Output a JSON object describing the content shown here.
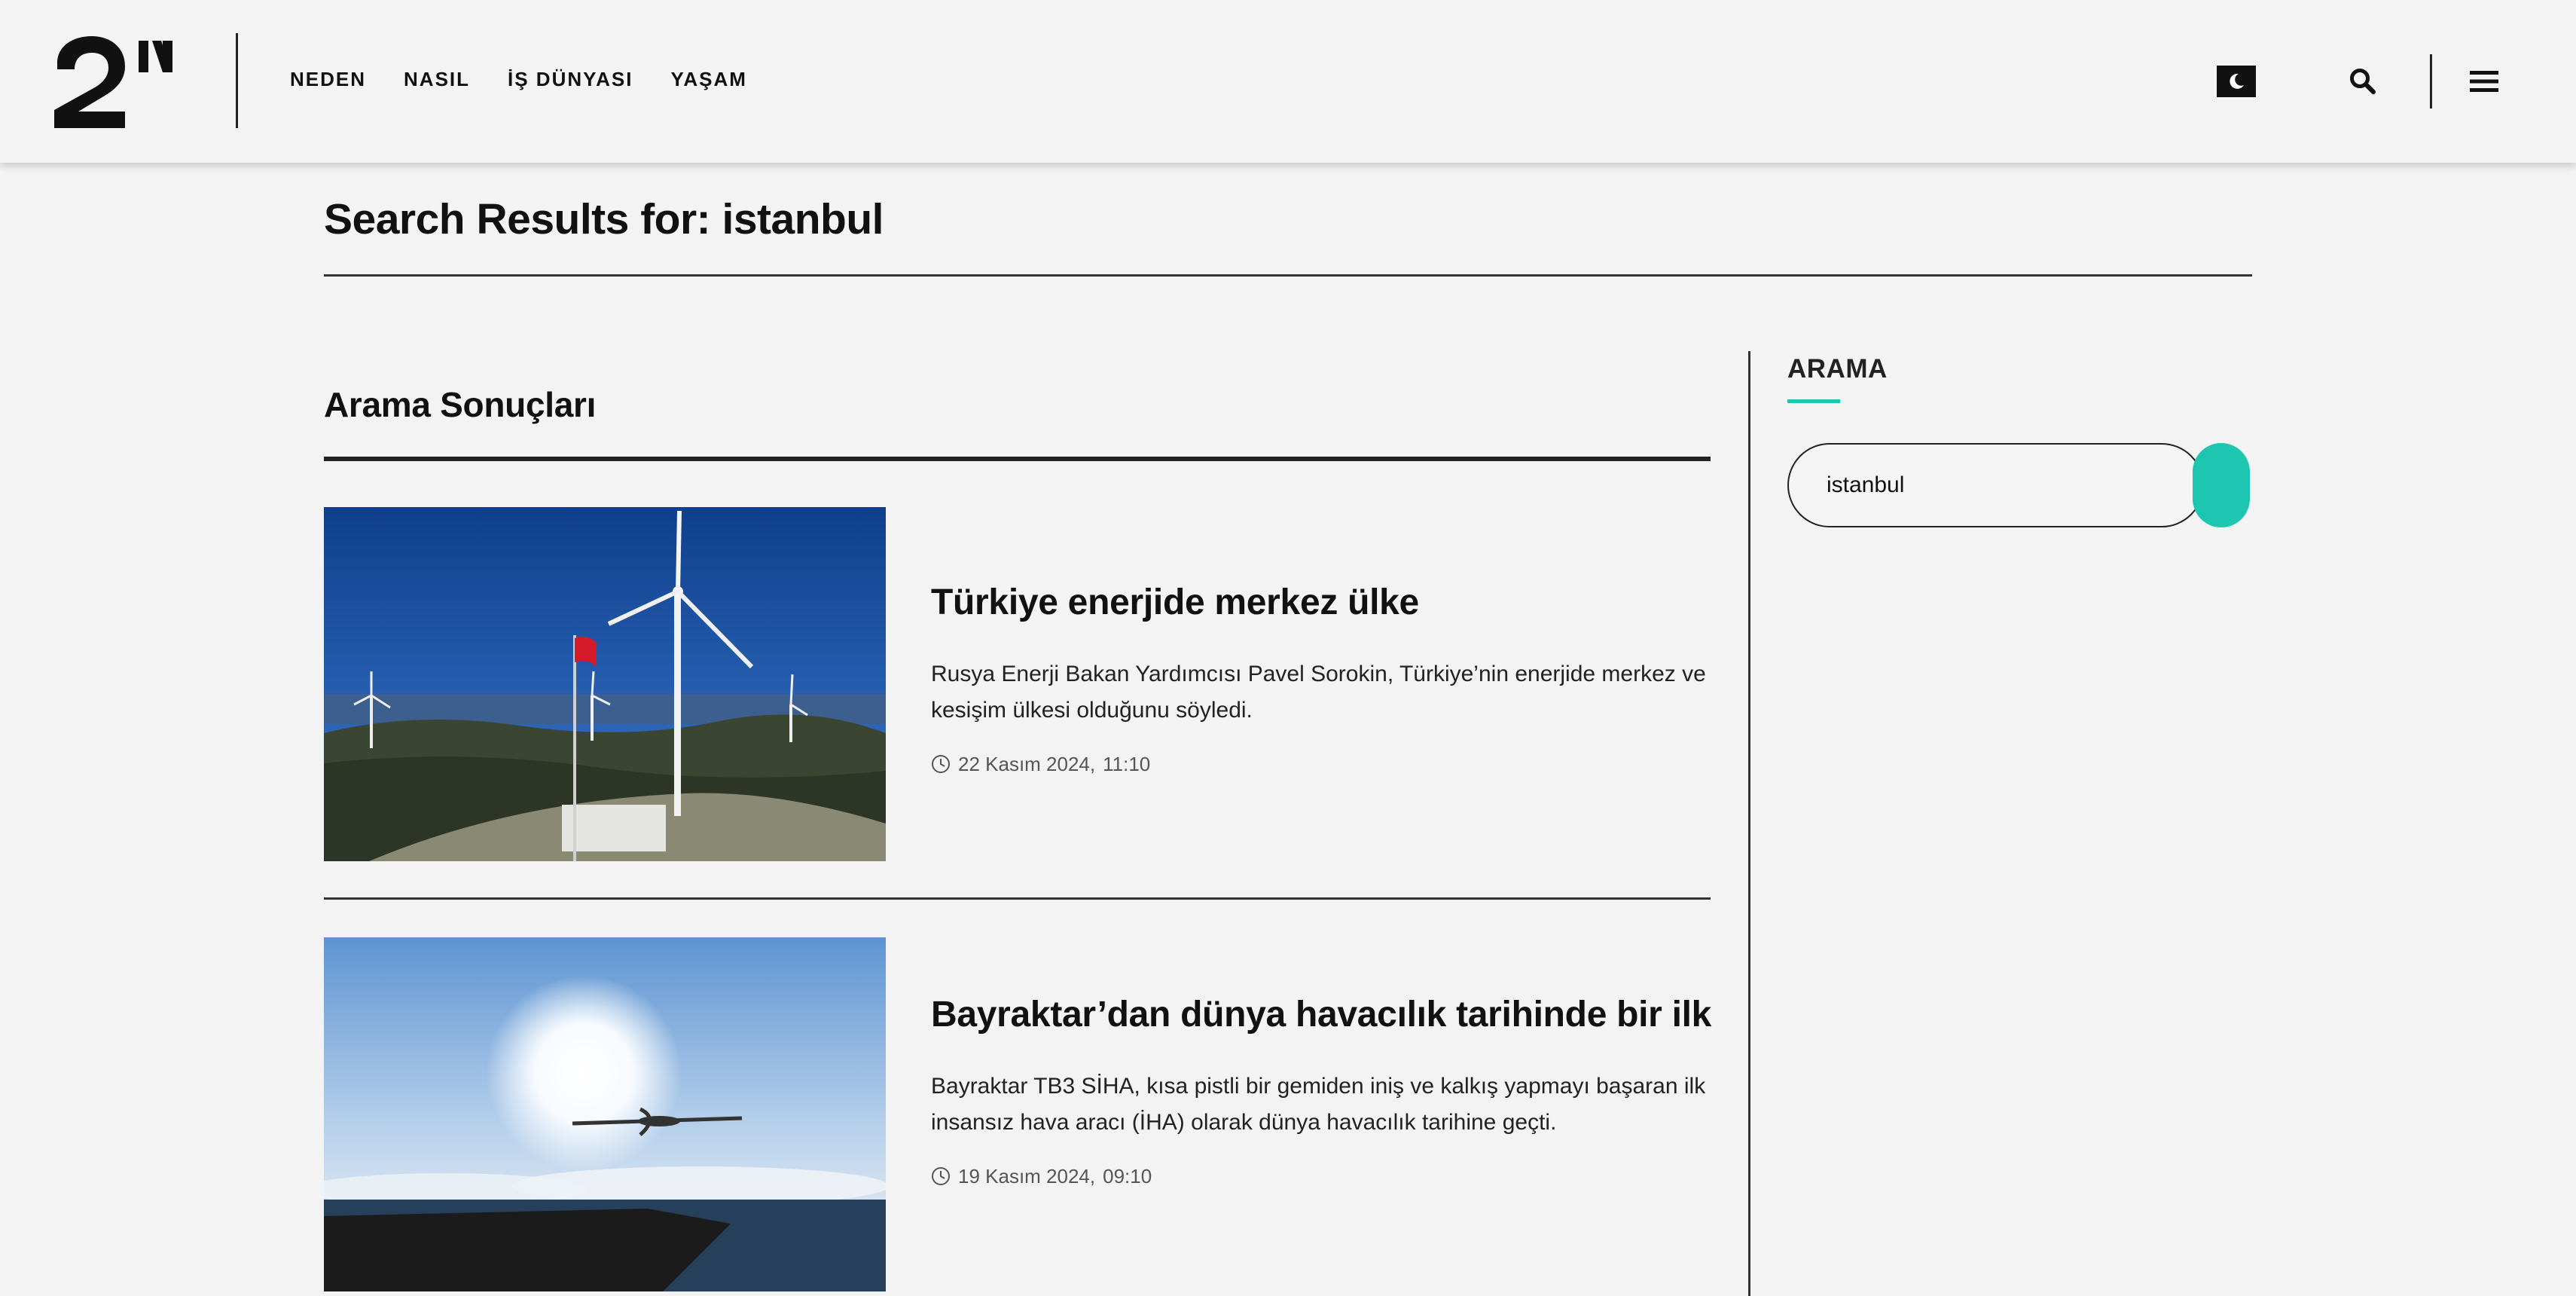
{
  "header": {
    "nav": [
      "NEDEN",
      "NASIL",
      "İŞ DÜNYASI",
      "YAŞAM"
    ]
  },
  "page": {
    "title": "Search Results for: istanbul",
    "section_title": "Arama Sonuçları"
  },
  "articles": [
    {
      "title": "Türkiye enerjide merkez ülke",
      "excerpt": "Rusya Enerji Bakan Yardımcısı Pavel Sorokin, Türkiye’nin enerjide merkez ve kesişim ülkesi olduğunu söyledi.",
      "date": "22 Kasım 2024,",
      "time": "11:10"
    },
    {
      "title": "Bayraktar’dan dünya havacılık tarihinde bir ilk",
      "excerpt": "Bayraktar TB3 SİHA, kısa pistli bir gemiden iniş ve kalkış yapmayı başaran ilk insansız hava aracı (İHA) olarak dünya havacılık tarihine geçti.",
      "date": "19 Kasım 2024,",
      "time": "09:10"
    }
  ],
  "sidebar": {
    "title": "ARAMA",
    "search_value": "istanbul"
  },
  "colors": {
    "accent": "#1dc6b0",
    "background": "#f3f3f3",
    "text": "#111111"
  },
  "icons": [
    "logo",
    "moon-icon",
    "search-icon",
    "menu-icon",
    "clock-icon"
  ]
}
